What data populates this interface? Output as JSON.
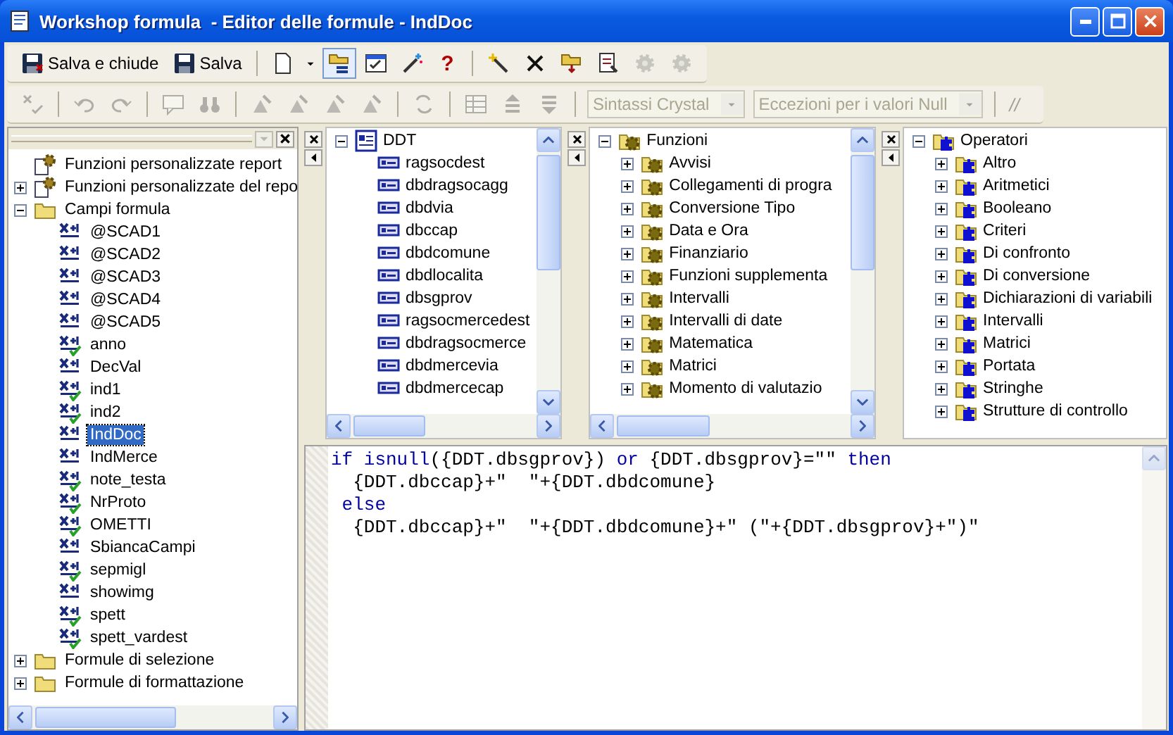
{
  "window": {
    "title": "Workshop formula  - Editor delle formule - IndDoc"
  },
  "toolbar_1": [
    {
      "kind": "save-close",
      "label": "Salva e chiude",
      "disabled": false,
      "on": false
    },
    {
      "kind": "save",
      "label": "Salva",
      "disabled": false,
      "on": false
    },
    {
      "kind": "separator"
    },
    {
      "kind": "new",
      "disabled": false,
      "on": false
    },
    {
      "kind": "menu",
      "disabled": false,
      "on": false
    },
    {
      "kind": "tree",
      "disabled": false,
      "on": true
    },
    {
      "kind": "properties",
      "disabled": false,
      "on": false
    },
    {
      "kind": "wand",
      "disabled": false,
      "on": false
    },
    {
      "kind": "help",
      "label": "?",
      "disabled": false,
      "on": false
    },
    {
      "kind": "separator"
    },
    {
      "kind": "sparkle",
      "disabled": false,
      "on": false
    },
    {
      "kind": "delete",
      "disabled": false,
      "on": false
    },
    {
      "kind": "folder-arrow",
      "disabled": false,
      "on": false
    },
    {
      "kind": "document",
      "disabled": false,
      "on": false
    },
    {
      "kind": "gear",
      "disabled": true,
      "on": false
    },
    {
      "kind": "gear",
      "disabled": true,
      "on": false
    }
  ],
  "toolbar_2": [
    {
      "kind": "check",
      "disabled": true
    },
    {
      "kind": "separator"
    },
    {
      "kind": "undo",
      "disabled": true
    },
    {
      "kind": "redo",
      "disabled": true
    },
    {
      "kind": "separator"
    },
    {
      "kind": "comment",
      "disabled": true
    },
    {
      "kind": "binoculars",
      "disabled": true
    },
    {
      "kind": "separator"
    },
    {
      "kind": "bookmark",
      "disabled": true
    },
    {
      "kind": "bookmark",
      "disabled": true
    },
    {
      "kind": "bookmark",
      "disabled": true
    },
    {
      "kind": "bookmark",
      "disabled": true
    },
    {
      "kind": "separator"
    },
    {
      "kind": "replace",
      "disabled": true
    },
    {
      "kind": "separator"
    },
    {
      "kind": "table",
      "disabled": true
    },
    {
      "kind": "up",
      "disabled": true
    },
    {
      "kind": "down",
      "disabled": true
    },
    {
      "kind": "separator"
    },
    {
      "kind": "combo",
      "label": "Sintassi Crystal",
      "disabled": true
    },
    {
      "kind": "combo",
      "label": "Eccezioni per i valori Null",
      "disabled": true
    },
    {
      "kind": "separator"
    },
    {
      "kind": "text",
      "label": "//",
      "disabled": true
    }
  ],
  "left_tree": [
    {
      "label": "Funzioni personalizzate report",
      "kind": "report-func",
      "selected": false
    },
    {
      "label": "Funzioni personalizzate del repo",
      "kind": "report-func",
      "expanded": false,
      "selected": false
    },
    {
      "label": "Campi formula",
      "kind": "folder",
      "expanded": true,
      "selected": false,
      "children": [
        {
          "label": "@SCAD1",
          "kind": "formula",
          "checked": false,
          "selected": false
        },
        {
          "label": "@SCAD2",
          "kind": "formula",
          "checked": false,
          "selected": false
        },
        {
          "label": "@SCAD3",
          "kind": "formula",
          "checked": false,
          "selected": false
        },
        {
          "label": "@SCAD4",
          "kind": "formula",
          "checked": false,
          "selected": false
        },
        {
          "label": "@SCAD5",
          "kind": "formula",
          "checked": false,
          "selected": false
        },
        {
          "label": "anno",
          "kind": "formula",
          "checked": true,
          "selected": false
        },
        {
          "label": "DecVal",
          "kind": "formula",
          "checked": false,
          "selected": false
        },
        {
          "label": "ind1",
          "kind": "formula",
          "checked": true,
          "selected": false
        },
        {
          "label": "ind2",
          "kind": "formula",
          "checked": true,
          "selected": false
        },
        {
          "label": "IndDoc",
          "kind": "formula",
          "checked": false,
          "selected": true
        },
        {
          "label": "IndMerce",
          "kind": "formula",
          "checked": false,
          "selected": false
        },
        {
          "label": "note_testa",
          "kind": "formula",
          "checked": true,
          "selected": false
        },
        {
          "label": "NrProto",
          "kind": "formula",
          "checked": true,
          "selected": false
        },
        {
          "label": "OMETTI",
          "kind": "formula",
          "checked": true,
          "selected": false
        },
        {
          "label": "SbiancaCampi",
          "kind": "formula",
          "checked": false,
          "selected": false
        },
        {
          "label": "sepmigl",
          "kind": "formula",
          "checked": true,
          "selected": false
        },
        {
          "label": "showimg",
          "kind": "formula",
          "checked": false,
          "selected": false
        },
        {
          "label": "spett",
          "kind": "formula",
          "checked": true,
          "selected": false
        },
        {
          "label": "spett_vardest",
          "kind": "formula",
          "checked": true,
          "selected": false
        }
      ]
    },
    {
      "label": "Formule di selezione",
      "kind": "folder",
      "expanded": false,
      "selected": false
    },
    {
      "label": "Formule di formattazione",
      "kind": "folder",
      "expanded": false,
      "selected": false
    }
  ],
  "panes": [
    {
      "tree": [
        {
          "label": "DDT",
          "kind": "table",
          "expanded": true,
          "children": [
            {
              "label": "ragsocdest",
              "kind": "field"
            },
            {
              "label": "dbdragsocagg",
              "kind": "field"
            },
            {
              "label": "dbdvia",
              "kind": "field"
            },
            {
              "label": "dbccap",
              "kind": "field"
            },
            {
              "label": "dbdcomune",
              "kind": "field"
            },
            {
              "label": "dbdlocalita",
              "kind": "field"
            },
            {
              "label": "dbsgprov",
              "kind": "field"
            },
            {
              "label": "ragsocmercedest",
              "kind": "field"
            },
            {
              "label": "dbdragsocmerce",
              "kind": "field"
            },
            {
              "label": "dbdmercevia",
              "kind": "field"
            },
            {
              "label": "dbdmercecap",
              "kind": "field"
            }
          ]
        }
      ]
    },
    {
      "tree": [
        {
          "label": "Funzioni",
          "kind": "gear-folder",
          "expanded": true,
          "children": [
            {
              "label": "Avvisi",
              "kind": "gear-folder",
              "expanded": false
            },
            {
              "label": "Collegamenti di progra",
              "kind": "gear-folder",
              "expanded": false
            },
            {
              "label": "Conversione Tipo",
              "kind": "gear-folder",
              "expanded": false
            },
            {
              "label": "Data e Ora",
              "kind": "gear-folder",
              "expanded": false
            },
            {
              "label": "Finanziario",
              "kind": "gear-folder",
              "expanded": false
            },
            {
              "label": "Funzioni supplementa",
              "kind": "gear-folder",
              "expanded": false
            },
            {
              "label": "Intervalli",
              "kind": "gear-folder",
              "expanded": false
            },
            {
              "label": "Intervalli di date",
              "kind": "gear-folder",
              "expanded": false
            },
            {
              "label": "Matematica",
              "kind": "gear-folder",
              "expanded": false
            },
            {
              "label": "Matrici",
              "kind": "gear-folder",
              "expanded": false
            },
            {
              "label": "Momento di valutazio",
              "kind": "gear-folder",
              "expanded": false
            }
          ]
        }
      ]
    },
    {
      "tree": [
        {
          "label": "Operatori",
          "kind": "op-folder",
          "expanded": true,
          "children": [
            {
              "label": "Altro",
              "kind": "op-folder",
              "expanded": false
            },
            {
              "label": "Aritmetici",
              "kind": "op-folder",
              "expanded": false
            },
            {
              "label": "Booleano",
              "kind": "op-folder",
              "expanded": false
            },
            {
              "label": "Criteri",
              "kind": "op-folder",
              "expanded": false
            },
            {
              "label": "Di confronto",
              "kind": "op-folder",
              "expanded": false
            },
            {
              "label": "Di conversione",
              "kind": "op-folder",
              "expanded": false
            },
            {
              "label": "Dichiarazioni di variabili",
              "kind": "op-folder",
              "expanded": false
            },
            {
              "label": "Intervalli",
              "kind": "op-folder",
              "expanded": false
            },
            {
              "label": "Matrici",
              "kind": "op-folder",
              "expanded": false
            },
            {
              "label": "Portata",
              "kind": "op-folder",
              "expanded": false
            },
            {
              "label": "Stringhe",
              "kind": "op-folder",
              "expanded": false
            },
            {
              "label": "Strutture di controllo",
              "kind": "op-folder",
              "expanded": false
            }
          ]
        }
      ]
    }
  ],
  "formula_editor": {
    "lines": [
      [
        {
          "kind": "keyword",
          "text": "if isnull"
        },
        {
          "kind": "plain",
          "text": "({DDT.dbsgprov}) "
        },
        {
          "kind": "keyword",
          "text": "or"
        },
        {
          "kind": "plain",
          "text": " {DDT.dbsgprov}=\"\" "
        },
        {
          "kind": "keyword",
          "text": "then"
        }
      ],
      [
        {
          "kind": "plain",
          "text": "  {DDT.dbccap}+\"  \"+{DDT.dbdcomune}"
        }
      ],
      [
        {
          "kind": "keyword",
          "text": " else"
        }
      ],
      [
        {
          "kind": "plain",
          "text": "  {DDT.dbccap}+\"  \"+{DDT.dbdcomune}+\" (\"+{DDT.dbsgprov}+\")\""
        }
      ]
    ]
  }
}
